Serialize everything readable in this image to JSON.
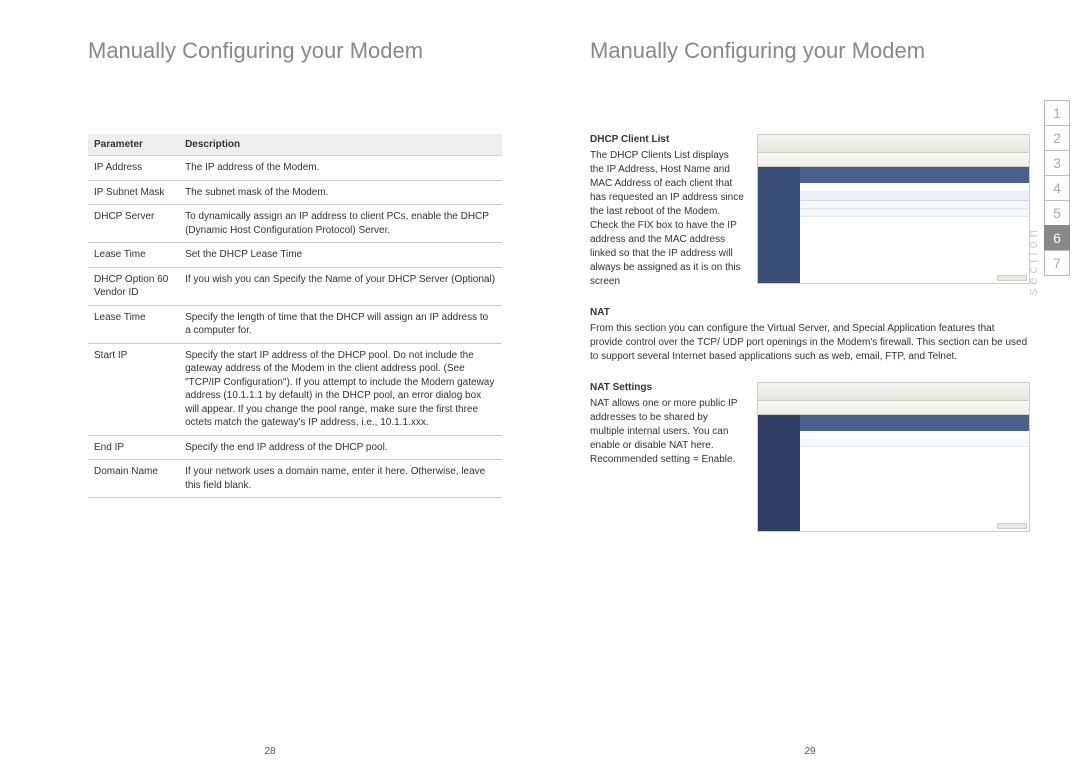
{
  "left": {
    "title": "Manually Configuring your Modem",
    "pageNumber": "28",
    "table": {
      "headers": [
        "Parameter",
        "Description"
      ],
      "rows": [
        {
          "param": "IP Address",
          "desc": "The IP address of the Modem."
        },
        {
          "param": "IP Subnet Mask",
          "desc": "The subnet mask of the Modem."
        },
        {
          "param": "DHCP Server",
          "desc": "To dynamically assign an IP address to client PCs, enable the DHCP (Dynamic Host Configuration Protocol) Server."
        },
        {
          "param": "Lease Time",
          "desc": "Set the DHCP Lease Time"
        },
        {
          "param": "DHCP Option 60 Vendor ID",
          "desc": "If you wish you can Specify the Name of your DHCP Server (Optional)"
        },
        {
          "param": "Lease Time",
          "desc": "Specify the length of time that the DHCP will assign an IP address to a computer for."
        },
        {
          "param": "Start IP",
          "desc": "Specify the start IP address of the DHCP pool. Do not include the gateway address of the Modem in the client address pool. (See \"TCP/IP Configuration\"). If you attempt to include the Modem gateway address (10.1.1.1 by default) in the DHCP pool, an error dialog box will appear. If you change the pool range, make sure the first three octets match the gateway's IP address, i.e., 10.1.1.xxx."
        },
        {
          "param": "End IP",
          "desc": "Specify the end IP address of the DHCP pool."
        },
        {
          "param": "Domain Name",
          "desc": "If your network uses a domain name, enter it here. Otherwise, leave this field blank."
        }
      ]
    }
  },
  "right": {
    "title": "Manually Configuring your Modem",
    "pageNumber": "29",
    "sections": {
      "dhcp": {
        "heading": "DHCP Client List",
        "body": "The DHCP Clients List displays the IP Address, Host Name and MAC Address of each client that has requested an IP address since the last reboot of the Modem. Check the FIX box to have the IP address and the MAC address linked so that the IP address will always be assigned as it is on this screen"
      },
      "nat": {
        "heading": "NAT",
        "body": "From this section you can configure the Virtual Server, and Special Application features that provide control over the TCP/ UDP port openings in the Modem's firewall. This section can be used to support several Internet based applications such as web, email, FTP, and Telnet."
      },
      "natSettings": {
        "heading": "NAT Settings",
        "body": "NAT allows one or more public IP addresses to be shared by multiple internal users.  You can enable or disable NAT here. Recommended setting = Enable."
      }
    },
    "tabs": [
      "1",
      "2",
      "3",
      "4",
      "5",
      "6",
      "7"
    ],
    "activeTab": "6",
    "sectionLabel": "section"
  }
}
